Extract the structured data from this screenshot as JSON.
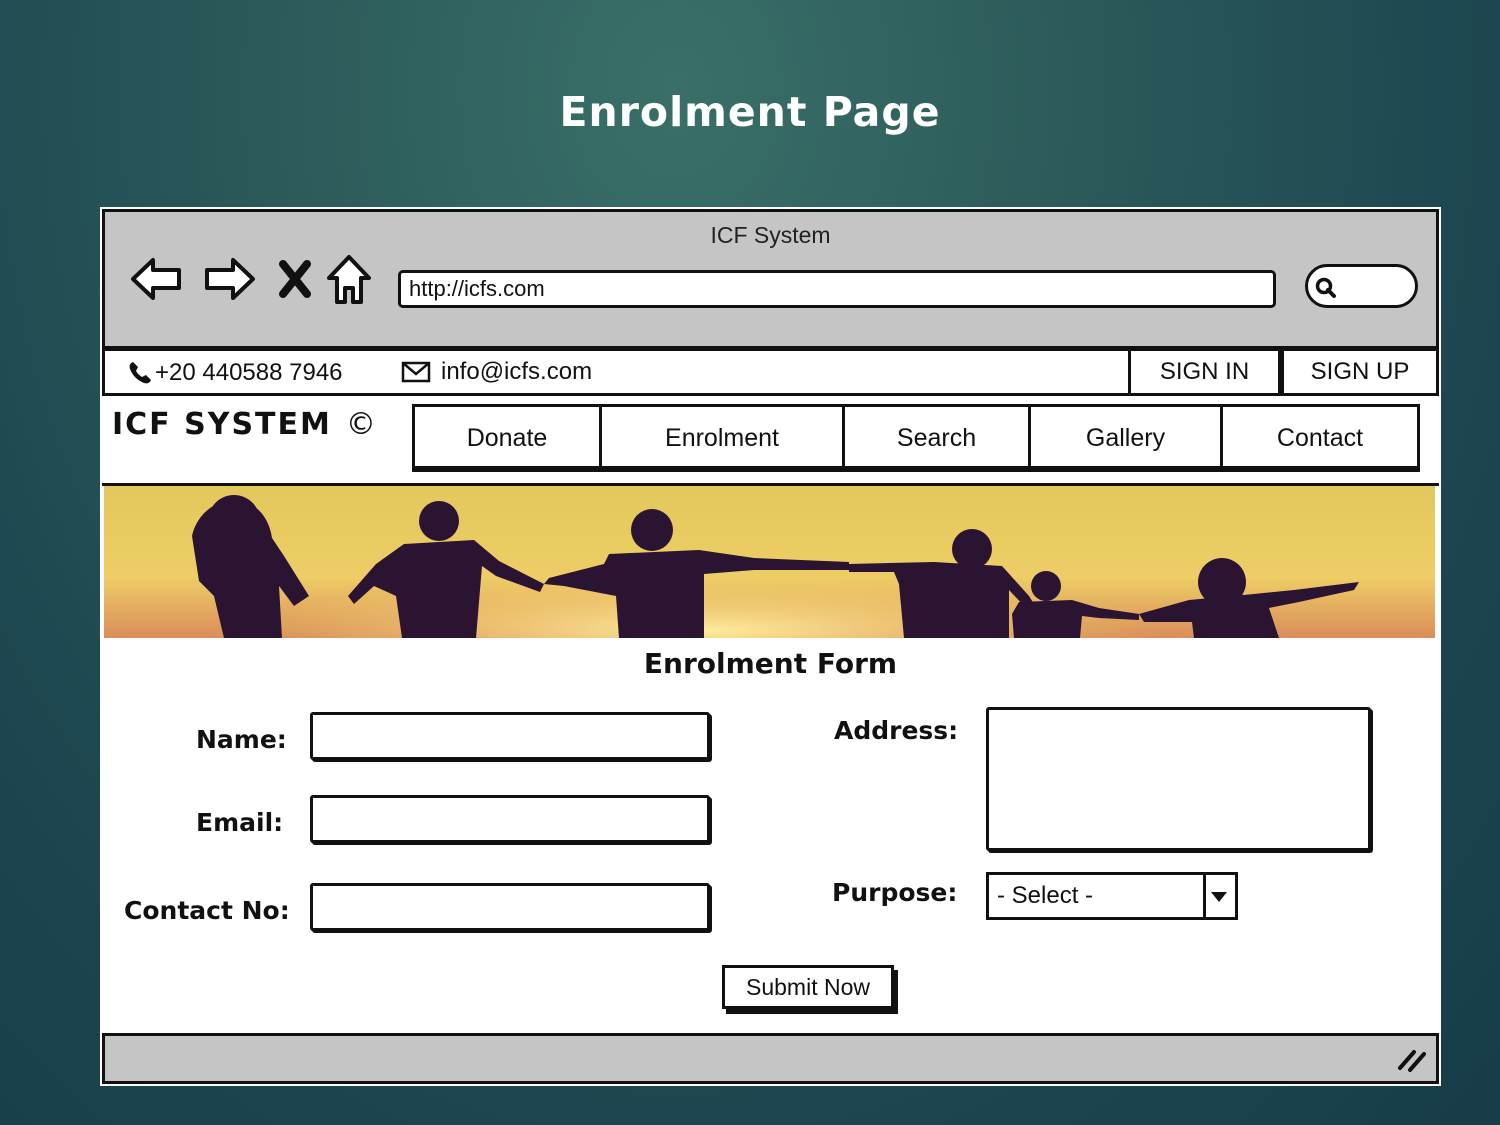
{
  "slide": {
    "title": "Enrolment Page"
  },
  "browser": {
    "window_title": "ICF System",
    "url": "http://icfs.com"
  },
  "topbar": {
    "phone": "+20 440588 7946",
    "email": "info@icfs.com",
    "sign_in": "SIGN IN",
    "sign_up": "SIGN UP"
  },
  "brand": {
    "name": "ICF SYSTEM",
    "symbol": "©"
  },
  "menu": {
    "items": [
      {
        "label": "Donate"
      },
      {
        "label": "Enrolment"
      },
      {
        "label": "Search"
      },
      {
        "label": "Gallery"
      },
      {
        "label": "Contact"
      }
    ]
  },
  "form": {
    "title": "Enrolment Form",
    "name_label": "Name:",
    "email_label": "Email:",
    "contact_label": "Contact No:",
    "address_label": "Address:",
    "purpose_label": "Purpose:",
    "purpose_selected": "- Select -",
    "submit_label": "Submit Now"
  },
  "icons": {
    "back": "back-arrow-icon",
    "forward": "forward-arrow-icon",
    "stop": "stop-x-icon",
    "home": "home-icon",
    "search": "search-icon",
    "phone": "phone-icon",
    "mail": "mail-icon",
    "grip": "resize-grip-icon"
  },
  "colors": {
    "background": "#1d4650",
    "chrome_gray": "#c5c5c5",
    "banner_sky_top": "#e2c95a",
    "banner_sun": "#f6d86a"
  }
}
